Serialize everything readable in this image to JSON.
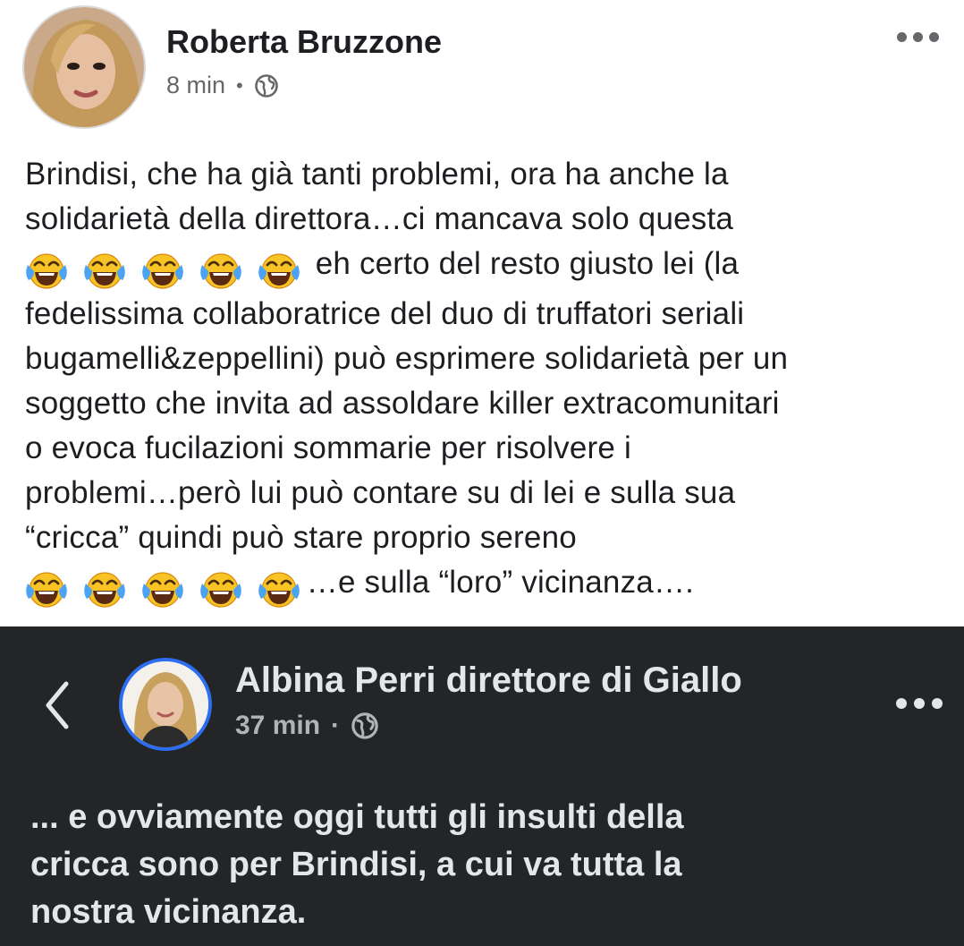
{
  "post": {
    "author": "Roberta Bruzzone",
    "time": "8 min",
    "separator": "•",
    "privacy_icon": "globe-icon",
    "lines": [
      "Brindisi, che ha già tanti problemi, ora ha anche la",
      "solidarietà della direttora…ci mancava solo questa",
      "eh certo del resto giusto lei (la",
      "fedelissima collaboratrice del duo di truffatori seriali",
      "bugamelli&zeppellini) può esprimere solidarietà per un",
      "soggetto che invita ad assoldare killer extracomunitari",
      "o evoca fucilazioni sommarie per risolvere i",
      "problemi…però lui può contare su di lei e sulla sua",
      "“cricca” quindi può stare proprio sereno",
      "…e sulla “loro” vicinanza…."
    ],
    "emoji": "face-with-tears-of-joy",
    "emoji_count": 5
  },
  "embedded_post": {
    "author": "Albina Perri direttore di Giallo",
    "time": "37 min",
    "separator": "·",
    "privacy_icon": "globe-icon",
    "lines": [
      "... e ovviamente oggi tutti gli insulti della",
      "cricca sono per Brindisi, a cui va tutta la",
      "nostra vicinanza."
    ]
  },
  "colors": {
    "light_bg": "#ffffff",
    "dark_bg": "#242526",
    "text_dark": "#1c1e21",
    "text_muted": "#65676b",
    "text_light": "#e4e6eb",
    "avatar_ring": "#2d6df0"
  }
}
